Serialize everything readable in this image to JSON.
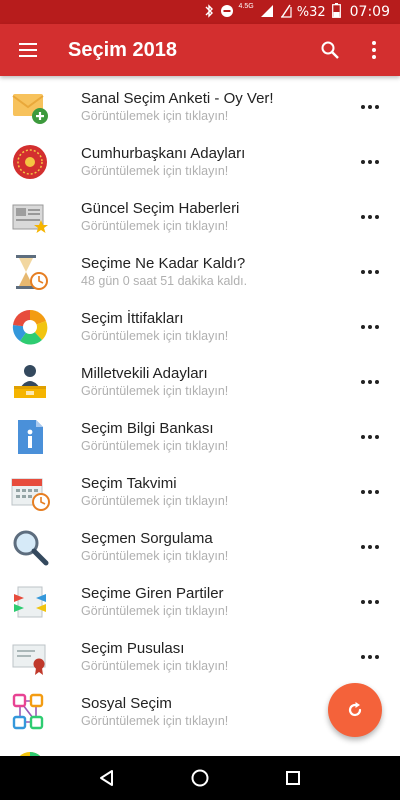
{
  "status_bar": {
    "network": "4.5G",
    "battery": "%32",
    "time": "07:09"
  },
  "app_bar": {
    "title": "Seçim 2018",
    "menu_icon": "hamburger-menu-icon",
    "search_icon": "search-icon",
    "overflow_icon": "more-vert-icon"
  },
  "items": [
    {
      "title": "Sanal Seçim Anketi - Oy Ver!",
      "subtitle": "Görüntülemek için tıklayın!",
      "icon": "envelope-add-icon"
    },
    {
      "title": "Cumhurbaşkanı Adayları",
      "subtitle": "Görüntülemek için tıklayın!",
      "icon": "presidential-seal-icon"
    },
    {
      "title": "Güncel Seçim Haberleri",
      "subtitle": "Görüntülemek için tıklayın!",
      "icon": "news-star-icon"
    },
    {
      "title": "Seçime Ne Kadar Kaldı?",
      "subtitle": "48 gün 0 saat 51 dakika kaldı.",
      "icon": "hourglass-clock-icon"
    },
    {
      "title": "Seçim İttifakları",
      "subtitle": "Görüntülemek için tıklayın!",
      "icon": "color-wheel-icon"
    },
    {
      "title": "Milletvekili Adayları",
      "subtitle": "Görüntülemek için tıklayın!",
      "icon": "speaker-podium-icon"
    },
    {
      "title": "Seçim Bilgi Bankası",
      "subtitle": "Görüntülemek için tıklayın!",
      "icon": "info-document-icon"
    },
    {
      "title": "Seçim Takvimi",
      "subtitle": "Görüntülemek için tıklayın!",
      "icon": "calendar-clock-icon"
    },
    {
      "title": "Seçmen Sorgulama",
      "subtitle": "Görüntülemek için tıklayın!",
      "icon": "magnifier-icon"
    },
    {
      "title": "Seçime Giren Partiler",
      "subtitle": "Görüntülemek için tıklayın!",
      "icon": "flags-document-icon"
    },
    {
      "title": "Seçim Pusulası",
      "subtitle": "Görüntülemek için tıklayın!",
      "icon": "certificate-icon"
    },
    {
      "title": "Sosyal Seçim",
      "subtitle": "Görüntülemek için tıklayın!",
      "icon": "social-network-icon"
    }
  ],
  "fab": {
    "icon": "refresh-icon"
  },
  "nav_bar": {
    "back_icon": "back-icon",
    "home_icon": "home-icon",
    "recents_icon": "recents-icon"
  },
  "colors": {
    "status_bar": "#b71c1c",
    "app_bar": "#d32f2f",
    "fab": "#f4623a",
    "title_text": "#222222",
    "subtitle_text": "#b0b0b0"
  }
}
